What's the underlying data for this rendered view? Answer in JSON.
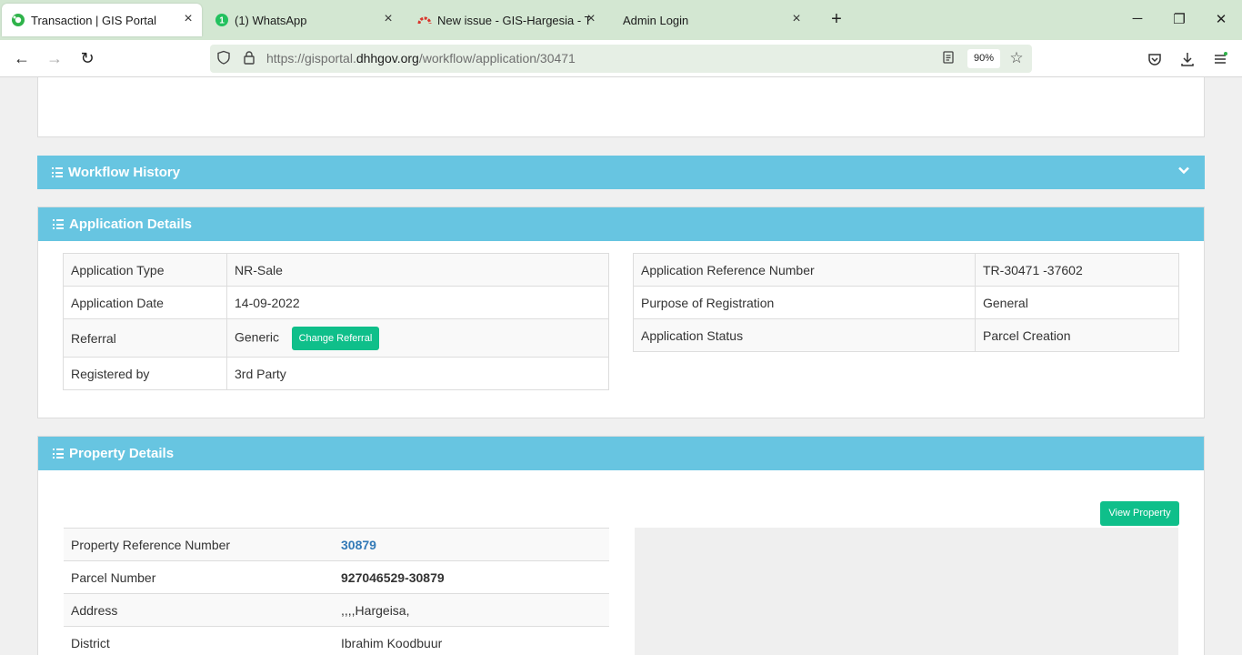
{
  "browser": {
    "tabs": [
      {
        "title": "Transaction | GIS Portal",
        "active": true
      },
      {
        "title": "(1) WhatsApp",
        "badge": "1"
      },
      {
        "title": "New issue - GIS-Hargesia - Team"
      },
      {
        "title": "Admin Login"
      }
    ],
    "url_prefix": "https://gisportal.",
    "url_domain": "dhhgov.org",
    "url_path": "/workflow/application/30471",
    "zoom": "90%"
  },
  "workflow_history": {
    "title": "Workflow History"
  },
  "application_details": {
    "title": "Application Details",
    "left": [
      {
        "label": "Application Type",
        "value": "NR-Sale"
      },
      {
        "label": "Application Date",
        "value": "14-09-2022"
      },
      {
        "label": "Referral",
        "value": "Generic"
      },
      {
        "label": "Registered by",
        "value": "3rd Party"
      }
    ],
    "change_referral_label": "Change Referral",
    "right": [
      {
        "label": "Application Reference Number",
        "value": "TR-30471 -37602"
      },
      {
        "label": "Purpose of Registration",
        "value": "General"
      },
      {
        "label": "Application Status",
        "value": "Parcel Creation"
      }
    ]
  },
  "property_details": {
    "title": "Property Details",
    "view_property_label": "View Property",
    "rows": [
      {
        "label": "Property Reference Number",
        "value": "30879"
      },
      {
        "label": "Parcel Number",
        "value": "927046529-30879"
      },
      {
        "label": "Address",
        "value": ",,,,Hargeisa,"
      },
      {
        "label": "District",
        "value": "Ibrahim Koodbuur"
      }
    ]
  },
  "colors": {
    "tabbar": "#d3e7d2",
    "panel_header": "#67c5e1",
    "button_green": "#0fbf8a",
    "link": "#337ab7"
  }
}
